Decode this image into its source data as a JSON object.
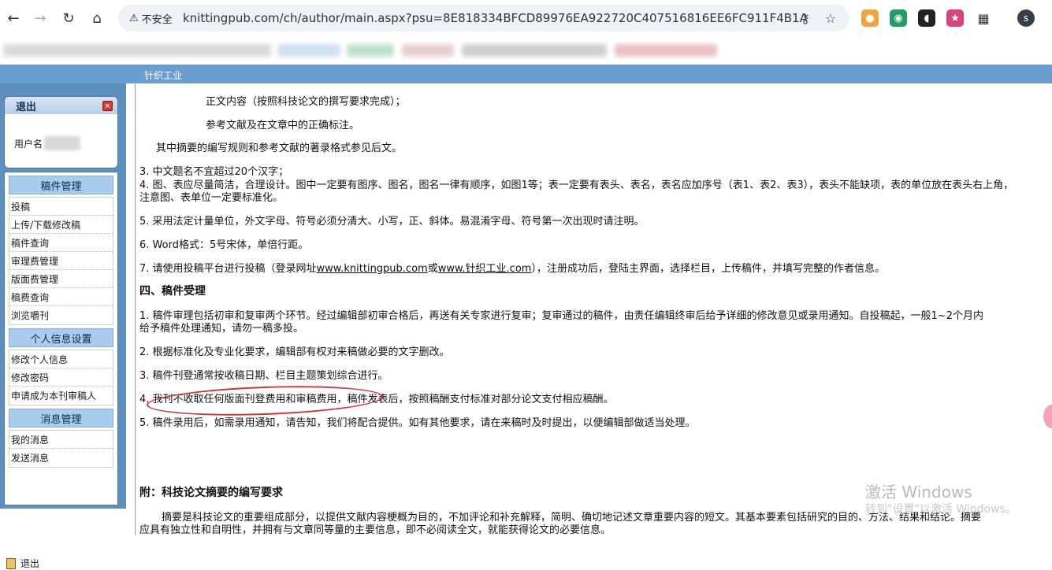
{
  "browser": {
    "security_label": "不安全",
    "url": "knittingpub.com/ch/author/main.aspx?psu=8E818334BFCD89976EA922720C407516816EE6FC911F4B1A",
    "profile_initial": "s"
  },
  "site": {
    "name": "针织工业"
  },
  "sidebar": {
    "login_title": "退出",
    "user_label": "用户名",
    "sections": [
      {
        "title": "稿件管理",
        "items": [
          "投稿",
          "上传/下载修改稿",
          "稿件查询",
          "审理费管理",
          "版面费管理",
          "稿费查询",
          "浏览嚼刊"
        ]
      },
      {
        "title": "个人信息设置",
        "items": [
          "修改个人信息",
          "修改密码",
          "申请成为本刊审稿人"
        ]
      },
      {
        "title": "消息管理",
        "items": [
          "我的消息",
          "发送消息"
        ]
      }
    ],
    "logout": "退出"
  },
  "content": {
    "l1": "正文内容（按照科技论文的撰写要求完成）；",
    "l2": "参考文献及在文章中的正确标注。",
    "l3": "其中摘要的编写规则和参考文献的著录格式参见后文。",
    "l4": "3. 中文题名不宜超过20个汉字；",
    "l5": "4. 图、表应尽量简洁，合理设计。图中一定要有图序、图名，图名一律有顺序，如图1等；表一定要有表头、表名，表名应加序号（表1、表2、表3），表头不能缺项，表的单位放在表头右上角，",
    "l5b": "注意图、表单位一定要标准化。",
    "l6": "5. 采用法定计量单位，外文字母、符号必须分清大、小写，正、斜体。易混淆字母、符号第一次出现时请注明。",
    "l7": "6.   Word格式：5号宋体，单倍行距。",
    "l8_pre": "7. 请使用投稿平台进行投稿（登录网址",
    "l8_link1": "www.knittingpub.com",
    "l8_mid": "或",
    "l8_link2": "www.针织工业.com",
    "l8_post": "），注册成功后，登陆主界面，选择栏目，上传稿件，并填写完整的作者信息。",
    "h4": "四、稿件受理",
    "p1": "1. 稿件审理包括初审和复审两个环节。经过编辑部初审合格后，再送有关专家进行复审；复审通过的稿件，由责任编辑终审后给予详细的修改意见或录用通知。自投稿起，一般1~2个月内",
    "p1b": "给予稿件处理通知，请勿一稿多投。",
    "p2": "2. 根据标准化及专业化要求，编辑部有权对来稿做必要的文字删改。",
    "p3": "3. 稿件刊登通常按收稿日期、栏目主题策划综合进行。",
    "p4": "4. 我刊不收取任何版面刊登费用和审稿费用，稿件发表后，按照稿酬支付标准对部分论文支付相应稿酬。",
    "p5": "5. 稿件录用后，如需录用通知，请告知，我们将配合提供。如有其他要求，请在来稿时及时提出，以便编辑部做适当处理。",
    "h_appendix": "附：科技论文摘要的编写要求",
    "a1": "摘要是科技论文的重要组成部分，以提供文献内容梗概为目的，不加评论和补充解释，简明、确切地记述文章重要内容的短文。其基本要素包括研究的目的、方法、结果和结论。摘要",
    "a1b": "应具有独立性和自明性，并拥有与文章同等量的主要信息，即不必阅读全文，就能获得论文的必要信息。"
  },
  "watermark": {
    "line1": "激活 Windows",
    "line2": "转到\"设置\"以激活 Windows。"
  },
  "colors": {
    "site_bar": "#6a9ed0",
    "sidebar_bg": "#5e90bf",
    "menu_head": "#a9ccee",
    "annotation": "#d0353a"
  }
}
